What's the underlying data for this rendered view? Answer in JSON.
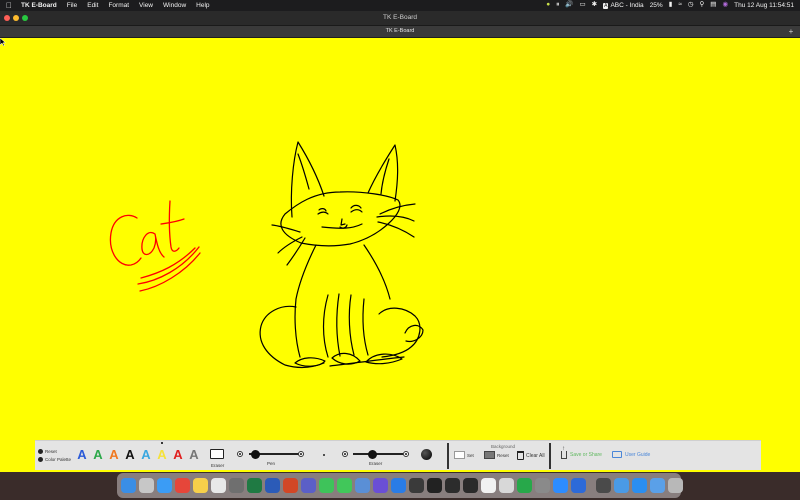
{
  "menubar": {
    "app_name": "TK E-Board",
    "menus": [
      "File",
      "Edit",
      "Format",
      "View",
      "Window",
      "Help"
    ],
    "input_source": "ABC - India",
    "input_source_badge": "A",
    "battery": "25%",
    "datetime": "Thu 12 Aug  11:54:51",
    "status_icons": [
      "bulb-icon",
      "pause-icon",
      "volume-icon",
      "screen-mirror-icon",
      "bluetooth-icon",
      "wifi-icon",
      "clock-icon",
      "search-icon",
      "control-center-icon",
      "siri-icon"
    ]
  },
  "window": {
    "title": "TK E-Board",
    "tab_title": "TK E-Board",
    "tab_add": "+"
  },
  "canvas": {
    "background_color": "#ffff00",
    "drawing_color": "#000000",
    "text_color": "#ff0000",
    "handwritten_text": "Cat"
  },
  "toolbar": {
    "reset_label": "Reset",
    "color_palette_label": "Color Palette",
    "pens": [
      {
        "glyph": "A",
        "color": "#2b5bd8"
      },
      {
        "glyph": "A",
        "color": "#2ca84a"
      },
      {
        "glyph": "A",
        "color": "#f07820"
      },
      {
        "glyph": "A",
        "color": "#111111"
      },
      {
        "glyph": "A",
        "color": "#39a7e0"
      },
      {
        "glyph": "A",
        "color": "#f5e23a"
      },
      {
        "glyph": "A",
        "color": "#e02020"
      },
      {
        "glyph": "A",
        "color": "#777777"
      }
    ],
    "eraser_label": "Eraser",
    "pen_slider_label": "Pen",
    "eraser_slider_label": "Eraser",
    "background_title": "Background",
    "set_label": "Set",
    "reset_bg_label": "Reset",
    "clear_all_label": "Clear All",
    "save_share_label": "Save or Share",
    "user_guide_label": "User Guide"
  },
  "dock": {
    "apps": [
      {
        "name": "finder-icon",
        "color": "#3a8ee6"
      },
      {
        "name": "launchpad-icon",
        "color": "#c7c7c7"
      },
      {
        "name": "safari-icon",
        "color": "#3b9cf5"
      },
      {
        "name": "chrome-icon",
        "color": "#e6463a"
      },
      {
        "name": "notes-icon",
        "color": "#f7d04a"
      },
      {
        "name": "sketch-icon",
        "color": "#e8e8e8"
      },
      {
        "name": "files-icon",
        "color": "#6f6f6f"
      },
      {
        "name": "excel-icon",
        "color": "#1f7a43"
      },
      {
        "name": "word-icon",
        "color": "#2b5bb8"
      },
      {
        "name": "powerpoint-icon",
        "color": "#d24726"
      },
      {
        "name": "teams-icon",
        "color": "#5b5fc7"
      },
      {
        "name": "facetime-icon",
        "color": "#3ec35a"
      },
      {
        "name": "messages-icon",
        "color": "#41c75a"
      },
      {
        "name": "preview-icon",
        "color": "#5a8fd6"
      },
      {
        "name": "imovie-icon",
        "color": "#6a4fd6"
      },
      {
        "name": "shazam-icon",
        "color": "#2a7ce6"
      },
      {
        "name": "calculator-icon",
        "color": "#3a3a3a"
      },
      {
        "name": "terminal-icon",
        "color": "#222222"
      },
      {
        "name": "console-icon",
        "color": "#2c2c2c"
      },
      {
        "name": "activity-icon",
        "color": "#2a2a2a"
      },
      {
        "name": "textedit-icon",
        "color": "#f2f2f2"
      },
      {
        "name": "pencil-icon",
        "color": "#d8d8d8"
      },
      {
        "name": "numbers-icon",
        "color": "#27a84a"
      },
      {
        "name": "system-prefs-icon",
        "color": "#8a8a8a"
      },
      {
        "name": "zoom-icon",
        "color": "#2d8cff"
      },
      {
        "name": "keynote-icon",
        "color": "#2d6ad8"
      },
      {
        "name": "vlc-icon",
        "color": "#4a4a4a"
      },
      {
        "name": "folder-icon",
        "color": "#4a9ae6"
      },
      {
        "name": "appstore-icon",
        "color": "#2a8ef0"
      },
      {
        "name": "downloads-icon",
        "color": "#5aa0e8"
      },
      {
        "name": "trash-icon",
        "color": "#b8b8b8"
      }
    ]
  }
}
